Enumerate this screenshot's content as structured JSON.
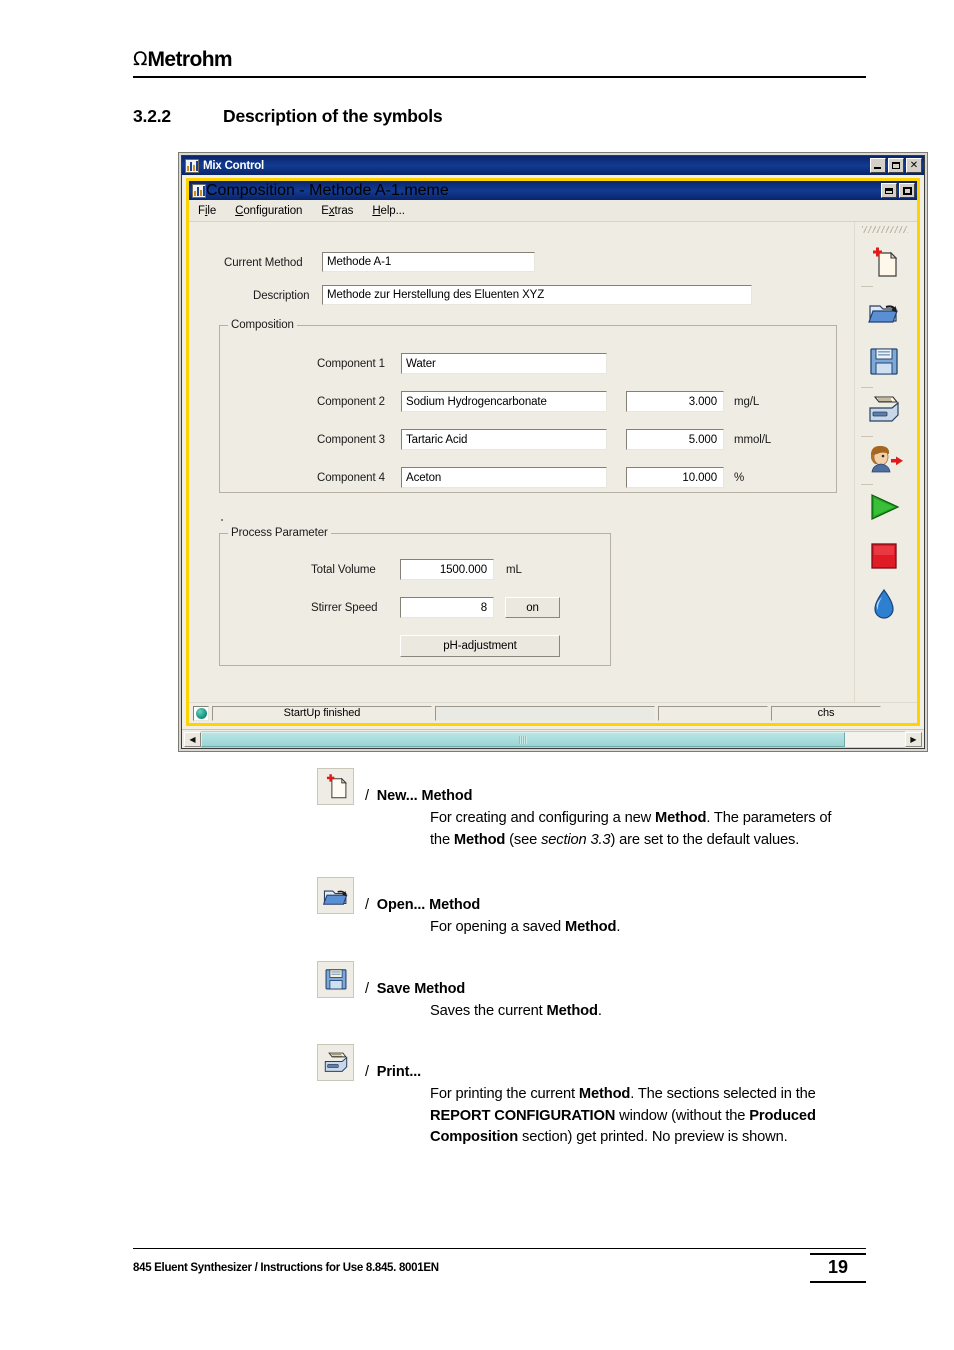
{
  "header": {
    "brand_omega": "Ω",
    "brand_name": "Metrohm"
  },
  "section": {
    "number": "3.2.2",
    "title": "Description of the symbols"
  },
  "screenshot": {
    "outer_window": {
      "title": "Mix Control",
      "icon": "bar-chart-app-icon",
      "buttons": [
        "minimize",
        "maximize",
        "close"
      ]
    },
    "child_window": {
      "title": "Composition - Methode A-1.meme",
      "icon": "bar-chart-app-icon",
      "buttons": [
        "restore-down",
        "maximize"
      ]
    },
    "menubar": [
      {
        "pre": "F",
        "accel": "i",
        "post": "le"
      },
      {
        "pre": "",
        "accel": "C",
        "post": "onfiguration"
      },
      {
        "pre": "E",
        "accel": "x",
        "post": "tras"
      },
      {
        "pre": "",
        "accel": "H",
        "post": "elp..."
      }
    ],
    "form": {
      "current_method_label": "Current Method",
      "current_method_value": "Methode A-1",
      "description_label": "Description",
      "description_value": "Methode zur Herstellung des Eluenten XYZ"
    },
    "composition": {
      "group_title": "Composition",
      "rows": [
        {
          "label": "Component 1",
          "name": "Water",
          "value": "",
          "unit": ""
        },
        {
          "label": "Component 2",
          "name": "Sodium Hydrogencarbonate",
          "value": "3.000",
          "unit": "mg/L"
        },
        {
          "label": "Component 3",
          "name": "Tartaric Acid",
          "value": "5.000",
          "unit": "mmol/L"
        },
        {
          "label": "Component 4",
          "name": "Aceton",
          "value": "10.000",
          "unit": "%"
        }
      ]
    },
    "process_parameter": {
      "group_title": "Process Parameter",
      "total_volume_label": "Total Volume",
      "total_volume_value": "1500.000",
      "total_volume_unit": "mL",
      "stirrer_speed_label": "Stirrer Speed",
      "stirrer_speed_value": "8",
      "stirrer_toggle_label": "on",
      "ph_button_label": "pH-adjustment"
    },
    "toolbar": [
      {
        "name": "new-method-icon",
        "tooltip": "New... Method"
      },
      {
        "name": "open-method-icon",
        "tooltip": "Open... Method"
      },
      {
        "name": "save-method-icon",
        "tooltip": "Save Method"
      },
      {
        "name": "print-icon",
        "tooltip": "Print..."
      },
      {
        "name": "user-login-icon",
        "tooltip": "Login"
      },
      {
        "name": "start-play-icon",
        "tooltip": "Start"
      },
      {
        "name": "stop-square-icon",
        "tooltip": "Stop"
      },
      {
        "name": "water-drop-icon",
        "tooltip": "Rinse"
      }
    ],
    "statusbar": {
      "led": "green",
      "cell1": "StartUp finished",
      "cell2": "",
      "cell3": "",
      "cell4": "chs"
    }
  },
  "symbols": [
    {
      "icon": "new-method-icon",
      "slash": "/",
      "label": "New... Method",
      "body_html": "For creating and configuring a new <b>Method</b>. The parameters of the <b>Method</b> (see <i>section 3.3</i>) are set to the default values."
    },
    {
      "icon": "open-method-icon",
      "slash": "/",
      "label": "Open... Method",
      "body_html": "For opening a saved <b>Method</b>."
    },
    {
      "icon": "save-method-icon",
      "slash": "/",
      "label": "Save Method",
      "body_html": "Saves the current <b>Method</b>."
    },
    {
      "icon": "print-icon",
      "slash": "/",
      "label": "Print...",
      "body_html": "For printing the current <b>Method</b>. The sections selected in the <b>REPORT CONFIGURATION</b> window (without the <b>Produced Composition</b> section) get printed. No preview is shown."
    }
  ],
  "footer": {
    "text": "845 Eluent Synthesizer / Instructions for Use   8.845. 8001EN",
    "page": "19"
  },
  "colors": {
    "titlebar_blue": "#0a246a",
    "mdi_frame_yellow": "#ffd300",
    "panel_gray": "#efece4",
    "scrollbar_teal": "#a8dedd",
    "led_green": "#1f9c86"
  }
}
